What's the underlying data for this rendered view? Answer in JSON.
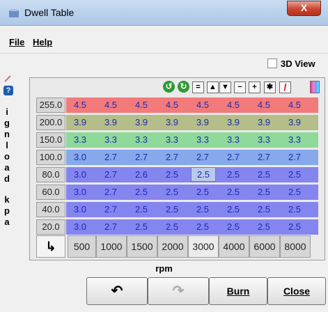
{
  "window": {
    "title": "Dwell Table",
    "close_glyph": "X"
  },
  "menu": [
    {
      "label": "File"
    },
    {
      "label": "Help"
    }
  ],
  "view3d": {
    "label": "3D View",
    "checked": false
  },
  "side_label_letters": [
    "i",
    "g",
    "n",
    "l",
    "o",
    "a",
    "d",
    "k",
    "p",
    "a"
  ],
  "side_icons": {
    "pencil": "pencil-icon",
    "help": "?"
  },
  "toolbar": {
    "buttons": [
      {
        "name": "rotate-up-icon",
        "glyph": "↺"
      },
      {
        "name": "rotate-down-icon",
        "glyph": "↻"
      },
      {
        "name": "equals-button",
        "glyph": "="
      },
      {
        "name": "increase-button",
        "glyph": "▲"
      },
      {
        "name": "decrease-button",
        "glyph": "▼"
      },
      {
        "name": "minus-button",
        "glyph": "−"
      },
      {
        "name": "plus-button",
        "glyph": "+"
      },
      {
        "name": "multiply-button",
        "glyph": "✱"
      },
      {
        "name": "pen-color-icon",
        "glyph": "/"
      }
    ]
  },
  "table": {
    "y_labels": [
      "255.0",
      "200.0",
      "150.0",
      "100.0",
      "80.0",
      "60.0",
      "40.0",
      "20.0"
    ],
    "x_labels": [
      "500",
      "1000",
      "1500",
      "2000",
      "3000",
      "4000",
      "6000",
      "8000"
    ],
    "rows": [
      [
        "4.5",
        "4.5",
        "4.5",
        "4.5",
        "4.5",
        "4.5",
        "4.5",
        "4.5"
      ],
      [
        "3.9",
        "3.9",
        "3.9",
        "3.9",
        "3.9",
        "3.9",
        "3.9",
        "3.9"
      ],
      [
        "3.3",
        "3.3",
        "3.3",
        "3.3",
        "3.3",
        "3.3",
        "3.3",
        "3.3"
      ],
      [
        "3.0",
        "2.7",
        "2.7",
        "2.7",
        "2.7",
        "2.7",
        "2.7",
        "2.7"
      ],
      [
        "3.0",
        "2.7",
        "2.6",
        "2.5",
        "2.5",
        "2.5",
        "2.5",
        "2.5"
      ],
      [
        "3.0",
        "2.7",
        "2.5",
        "2.5",
        "2.5",
        "2.5",
        "2.5",
        "2.5"
      ],
      [
        "3.0",
        "2.7",
        "2.5",
        "2.5",
        "2.5",
        "2.5",
        "2.5",
        "2.5"
      ],
      [
        "3.0",
        "2.7",
        "2.5",
        "2.5",
        "2.5",
        "2.5",
        "2.5",
        "2.5"
      ]
    ],
    "row_colors": [
      "#f37a7a",
      "#b5bd88",
      "#8fd99a",
      "#85a9ea",
      "#8585f0",
      "#8585f0",
      "#8585f0",
      "#8585f0"
    ],
    "selected_cell": {
      "row": 4,
      "col": 4,
      "color": "#b9c9ea"
    },
    "x_axis_label": "rpm",
    "corner_glyph": "↳"
  },
  "buttons": {
    "undo": {
      "glyph": "↶"
    },
    "redo": {
      "glyph": "↷"
    },
    "burn": "Burn",
    "close": "Close"
  }
}
